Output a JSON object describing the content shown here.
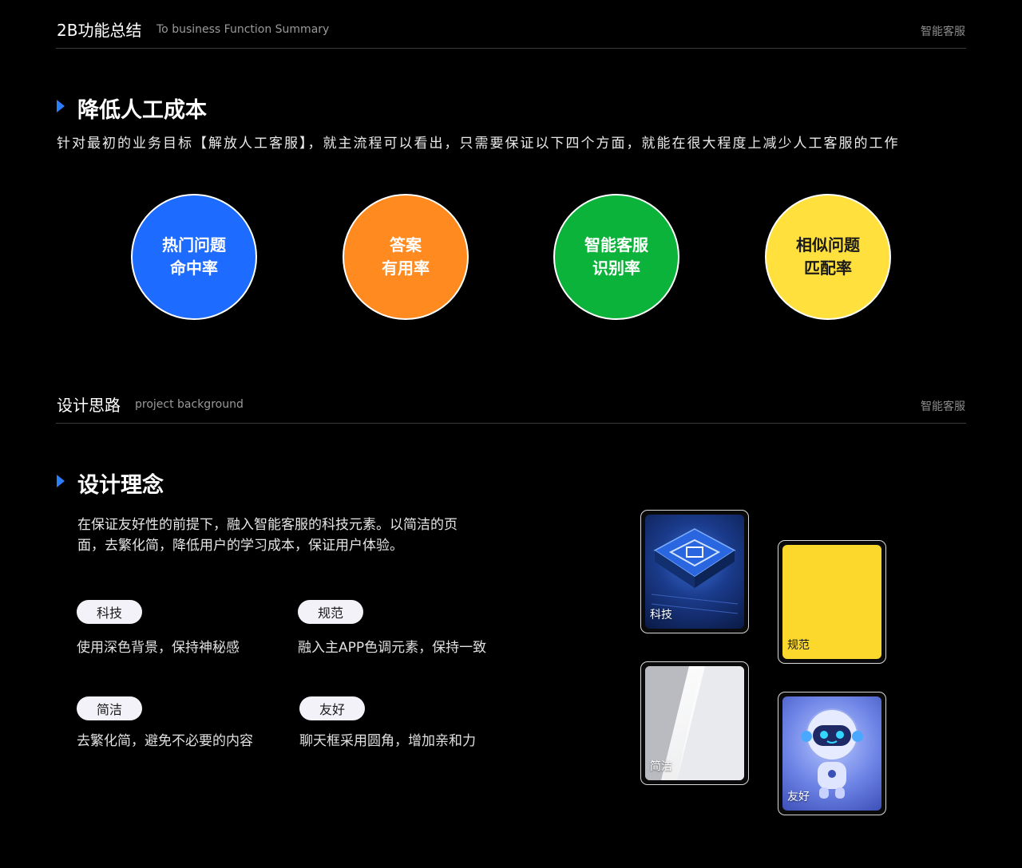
{
  "header1": {
    "title": "2B功能总结",
    "subtitle": "To business Function Summary",
    "right": "智能客服"
  },
  "section1": {
    "title": "降低人工成本",
    "desc": "针对最初的业务目标【解放人工客服】，就主流程可以看出，只需要保证以下四个方面，就能在很大程度上减少人工客服的工作",
    "circles": [
      {
        "line1": "热门问题",
        "line2": "命中率",
        "color": "#1e6bff",
        "text_color": "#ffffff"
      },
      {
        "line1": "答案",
        "line2": "有用率",
        "color": "#ff8a1f",
        "text_color": "#ffffff"
      },
      {
        "line1": "智能客服",
        "line2": "识别率",
        "color": "#0cb33a",
        "text_color": "#ffffff"
      },
      {
        "line1": "相似问题",
        "line2": "匹配率",
        "color": "#ffe03d",
        "text_color": "#1a1a1a"
      }
    ]
  },
  "header2": {
    "title": "设计思路",
    "subtitle": "project background",
    "right": "智能客服"
  },
  "section2": {
    "title": "设计理念",
    "paragraph_line1": "在保证友好性的前提下，融入智能客服的科技元素。以简洁的页",
    "paragraph_line2": "面，去繁化简，降低用户的学习成本，保证用户体验。",
    "principles": [
      {
        "tag": "科技",
        "desc": "使用深色背景，保持神秘感"
      },
      {
        "tag": "规范",
        "desc": "融入主APP色调元素，保持一致"
      },
      {
        "tag": "简洁",
        "desc": "去繁化简，避免不必要的内容"
      },
      {
        "tag": "友好",
        "desc": "聊天框采用圆角，增加亲和力"
      }
    ],
    "cards": [
      {
        "label": "科技",
        "icon": "chip-image"
      },
      {
        "label": "规范",
        "icon": "yellow-swatch"
      },
      {
        "label": "简洁",
        "icon": "white-geometry-image"
      },
      {
        "label": "友好",
        "icon": "robot-image"
      }
    ]
  }
}
